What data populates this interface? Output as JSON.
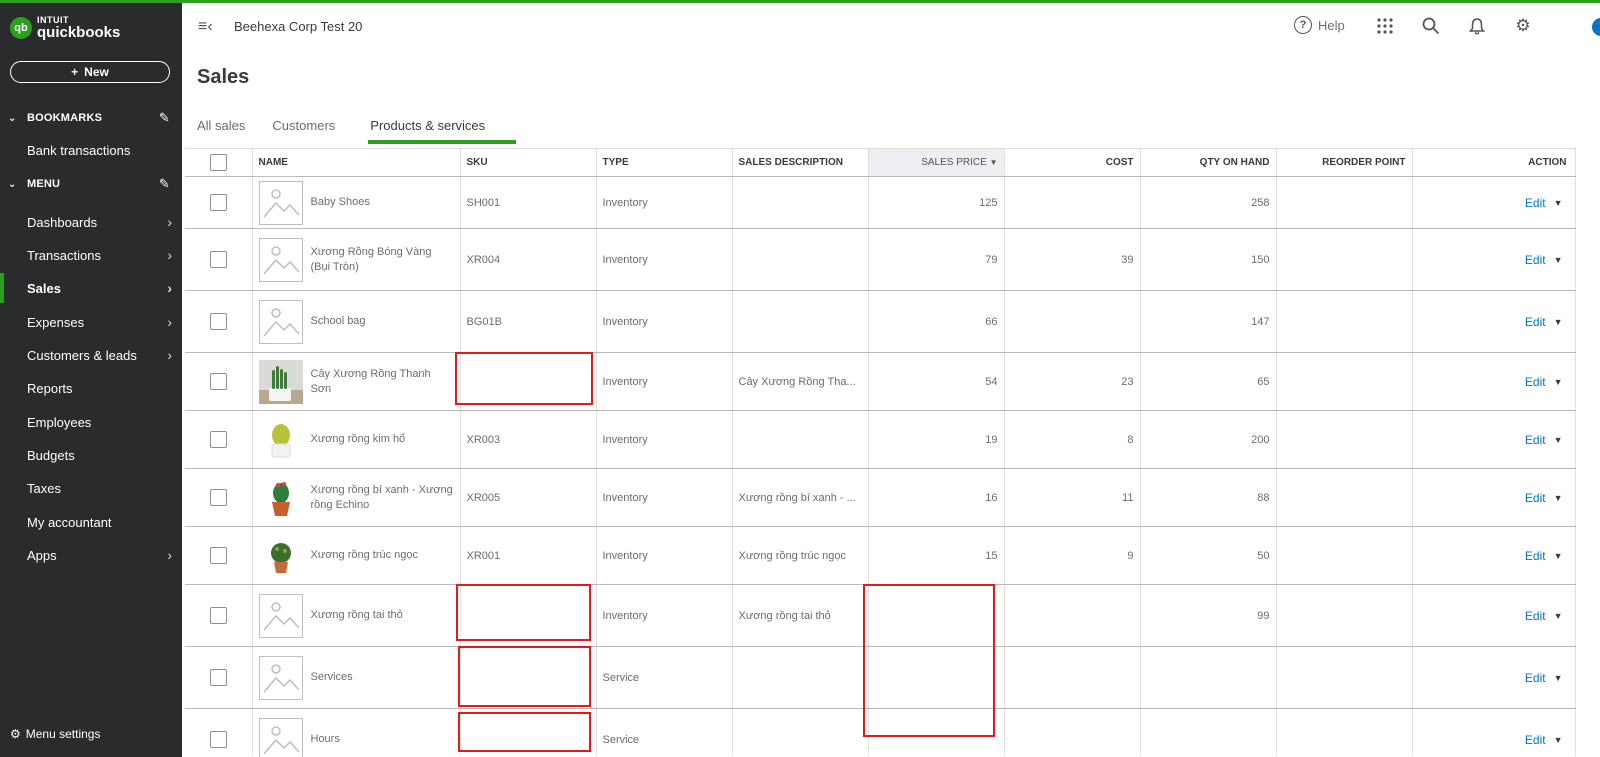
{
  "logo": {
    "brand": "INTUIT",
    "product": "quickbooks",
    "badge": "qb"
  },
  "sidebar": {
    "new_label": "New",
    "bookmarks_label": "BOOKMARKS",
    "bookmark_items": [
      "Bank transactions"
    ],
    "menu_label": "MENU",
    "menu_items": [
      {
        "label": "Dashboards",
        "arrow": true
      },
      {
        "label": "Transactions",
        "arrow": true
      },
      {
        "label": "Sales",
        "arrow": true,
        "active": true
      },
      {
        "label": "Expenses",
        "arrow": true
      },
      {
        "label": "Customers & leads",
        "arrow": true
      },
      {
        "label": "Reports",
        "arrow": false
      },
      {
        "label": "Employees",
        "arrow": false
      },
      {
        "label": "Budgets",
        "arrow": false
      },
      {
        "label": "Taxes",
        "arrow": false
      },
      {
        "label": "My accountant",
        "arrow": false
      },
      {
        "label": "Apps",
        "arrow": true
      }
    ],
    "menu_settings_label": "Menu settings"
  },
  "header": {
    "company": "Beehexa Corp Test 20",
    "help_label": "Help"
  },
  "page": {
    "title": "Sales"
  },
  "tabs": [
    {
      "label": "All sales"
    },
    {
      "label": "Customers"
    },
    {
      "label": "Products & services",
      "active": true
    }
  ],
  "table": {
    "columns": [
      "NAME",
      "SKU",
      "TYPE",
      "SALES DESCRIPTION",
      "SALES PRICE",
      "COST",
      "QTY ON HAND",
      "REORDER POINT",
      "ACTION"
    ],
    "sorted_column": "SALES PRICE",
    "edit_label": "Edit",
    "rows": [
      {
        "name": "Baby Shoes",
        "sku": "SH001",
        "type": "Inventory",
        "desc": "",
        "price": "125",
        "cost": "",
        "qty": "258",
        "reorder": "",
        "img": "placeholder"
      },
      {
        "name": "Xương Rồng Bóng Vàng (Bụi Tròn)",
        "sku": "XR004",
        "type": "Inventory",
        "desc": "",
        "price": "79",
        "cost": "39",
        "qty": "150",
        "reorder": "",
        "img": "placeholder"
      },
      {
        "name": "School bag",
        "sku": "BG01B",
        "type": "Inventory",
        "desc": "",
        "price": "66",
        "cost": "",
        "qty": "147",
        "reorder": "",
        "img": "placeholder"
      },
      {
        "name": "Cây Xương Rồng Thanh Sơn",
        "sku": "",
        "type": "Inventory",
        "desc": "Cây Xương Rồng Tha...",
        "price": "54",
        "cost": "23",
        "qty": "65",
        "reorder": "",
        "img": "cactus-white"
      },
      {
        "name": "Xương rồng kim hổ",
        "sku": "XR003",
        "type": "Inventory",
        "desc": "",
        "price": "19",
        "cost": "8",
        "qty": "200",
        "reorder": "",
        "img": "cactus-ball"
      },
      {
        "name": "Xương rồng bí xanh - Xương rồng Echino",
        "sku": "XR005",
        "type": "Inventory",
        "desc": "Xương rồng bí xanh - ...",
        "price": "16",
        "cost": "11",
        "qty": "88",
        "reorder": "",
        "img": "cactus-pot"
      },
      {
        "name": "Xương rồng trúc ngọc",
        "sku": "XR001",
        "type": "Inventory",
        "desc": "Xương rồng trúc ngọc",
        "price": "15",
        "cost": "9",
        "qty": "50",
        "reorder": "",
        "img": "cactus-round"
      },
      {
        "name": "Xương rồng tai thỏ",
        "sku": "",
        "type": "Inventory",
        "desc": "Xương rồng tai thỏ",
        "price": "",
        "cost": "",
        "qty": "99",
        "reorder": "",
        "img": "placeholder"
      },
      {
        "name": "Services",
        "sku": "",
        "type": "Service",
        "desc": "",
        "price": "",
        "cost": "",
        "qty": "",
        "reorder": "",
        "img": "placeholder"
      },
      {
        "name": "Hours",
        "sku": "",
        "type": "Service",
        "desc": "",
        "price": "",
        "cost": "",
        "qty": "",
        "reorder": "",
        "img": "placeholder"
      }
    ]
  },
  "colors": {
    "accent": "#2ca01c",
    "sidebar_bg": "#2a2b2d",
    "link": "#0077c5",
    "redaction": "#e01b1b"
  }
}
